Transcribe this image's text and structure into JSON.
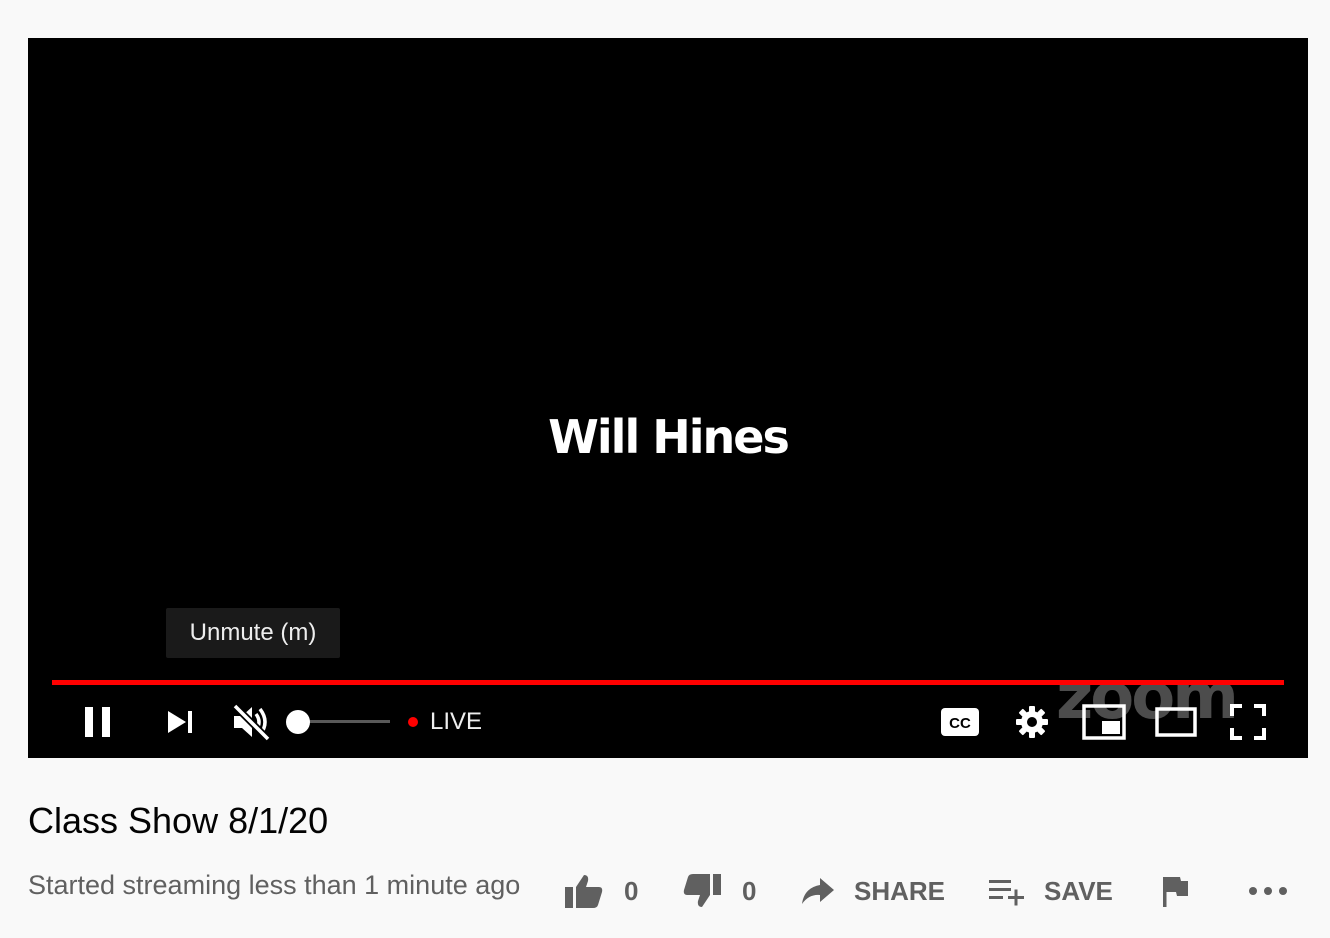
{
  "player": {
    "video_text": "Will Hines",
    "watermark": "zoom",
    "tooltip": "Unmute (m)",
    "live_label": "LIVE",
    "volume_level": 0,
    "progress_fraction": 1.0,
    "icons": [
      "pause-icon",
      "next-icon",
      "muted-volume-icon",
      "cc-icon",
      "gear-icon",
      "miniplayer-icon",
      "theater-icon",
      "fullscreen-icon"
    ],
    "accent_color": "#ff0000"
  },
  "video": {
    "title": "Class Show 8/1/20",
    "status": "Started streaming less than 1 minute ago",
    "likes": "0",
    "dislikes": "0",
    "share_label": "SHARE",
    "save_label": "SAVE",
    "icons": [
      "thumbs-up-icon",
      "thumbs-down-icon",
      "share-icon",
      "playlist-add-icon",
      "flag-icon",
      "more-icon"
    ]
  }
}
